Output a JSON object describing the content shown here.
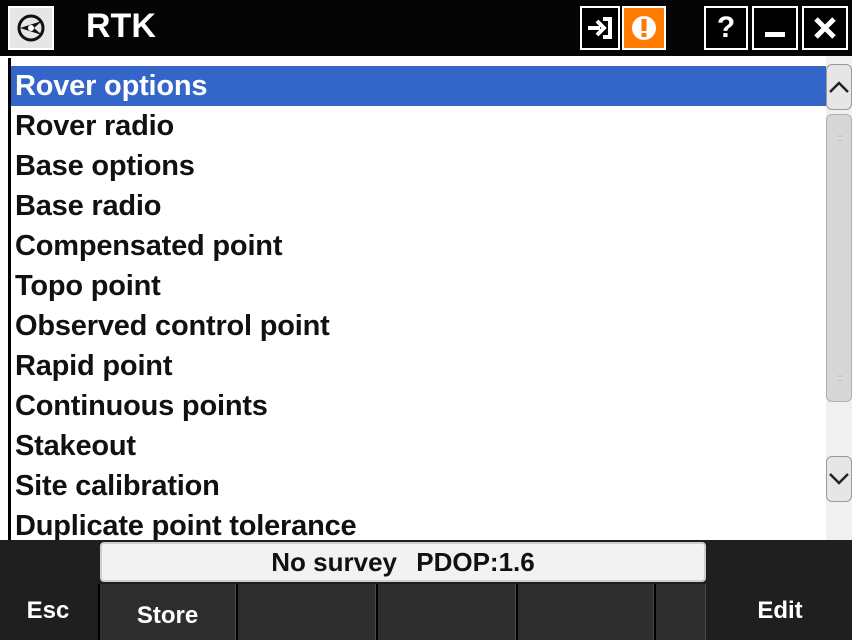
{
  "titlebar": {
    "title": "RTK",
    "icons": {
      "app": "satellite-app-icon",
      "login": "login-arrow-icon",
      "alert": "exclamation-alert-icon",
      "help_label": "?",
      "minimize": "minimize-icon",
      "close": "close-icon"
    },
    "alert_color": "#ff7a00"
  },
  "list": {
    "selected_index": 0,
    "selected_color": "#3465c8",
    "items": [
      {
        "label": "Rover options"
      },
      {
        "label": "Rover radio"
      },
      {
        "label": "Base options"
      },
      {
        "label": "Base radio"
      },
      {
        "label": "Compensated point"
      },
      {
        "label": "Topo point"
      },
      {
        "label": "Observed control point"
      },
      {
        "label": "Rapid point"
      },
      {
        "label": "Continuous points"
      },
      {
        "label": "Stakeout"
      },
      {
        "label": "Site calibration"
      },
      {
        "label": "Duplicate point tolerance"
      }
    ]
  },
  "scrollbar": {
    "up_icon": "chevron-up-icon",
    "down_icon": "chevron-down-icon"
  },
  "status": {
    "survey": "No survey",
    "pdop": "PDOP:1.6"
  },
  "buttons": {
    "esc": "Esc",
    "edit": "Edit",
    "softkeys": [
      "Store",
      "",
      "",
      "",
      ""
    ]
  }
}
